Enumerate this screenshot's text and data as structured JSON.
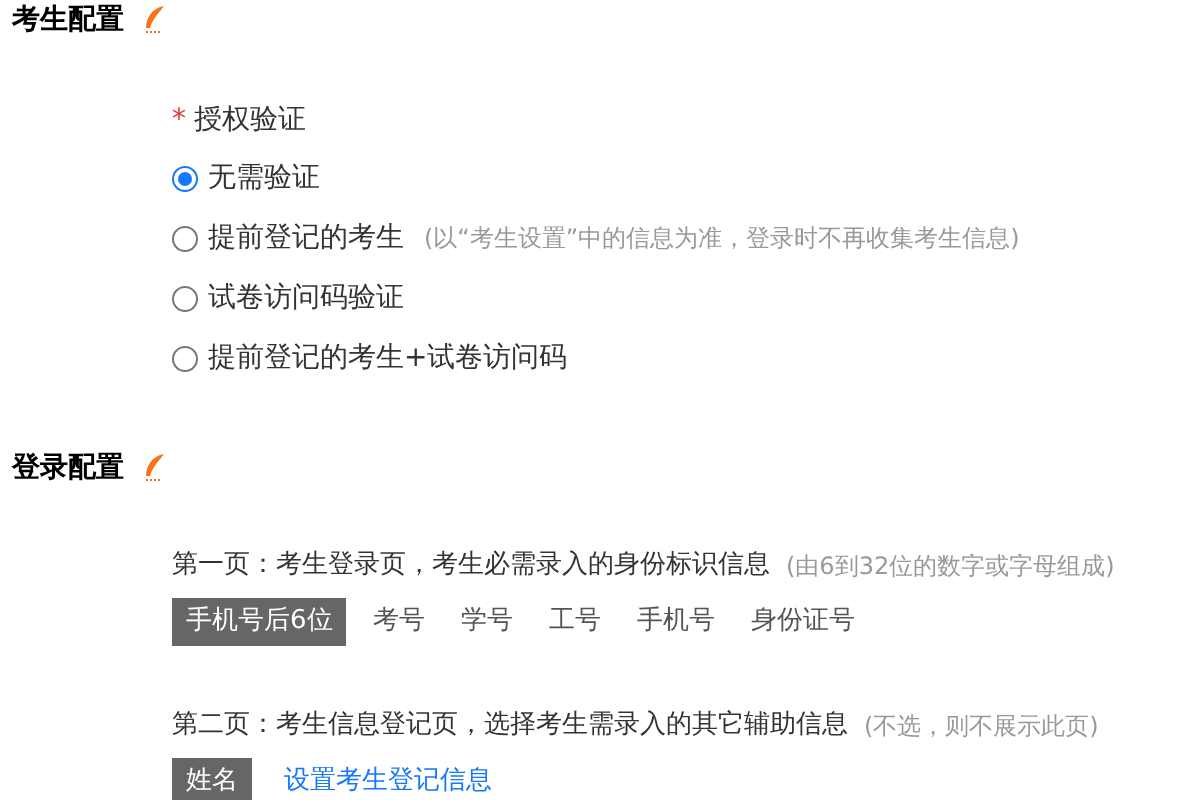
{
  "sections": [
    {
      "kind": "auth",
      "title": "考生配置",
      "field": {
        "required_mark": "*",
        "label": "授权验证"
      },
      "options": [
        {
          "label": "无需验证",
          "selected": true
        },
        {
          "label": "提前登记的考生",
          "hint": "(以“考生设置”中的信息为准，登录时不再收集考生信息)",
          "selected": false
        },
        {
          "label": "试卷访问码验证",
          "selected": false
        },
        {
          "label": "提前登记的考生+试卷访问码",
          "selected": false
        }
      ]
    },
    {
      "kind": "login",
      "title": "登录配置",
      "pages": [
        {
          "label": "第一页：考生登录页，考生必需录入的身份标识信息",
          "hint": "(由6到32位的数字或字母组成)",
          "chips": [
            {
              "label": "手机号后6位",
              "selected": true
            },
            {
              "label": "考号",
              "selected": false
            },
            {
              "label": "学号",
              "selected": false
            },
            {
              "label": "工号",
              "selected": false
            },
            {
              "label": "手机号",
              "selected": false
            },
            {
              "label": "身份证号",
              "selected": false
            }
          ]
        },
        {
          "label": "第二页：考生信息登记页，选择考生需录入的其它辅助信息",
          "hint": "(不选，则不展示此页)",
          "chips": [
            {
              "label": "姓名",
              "selected": true
            }
          ],
          "link": "设置考生登记信息"
        }
      ]
    }
  ]
}
